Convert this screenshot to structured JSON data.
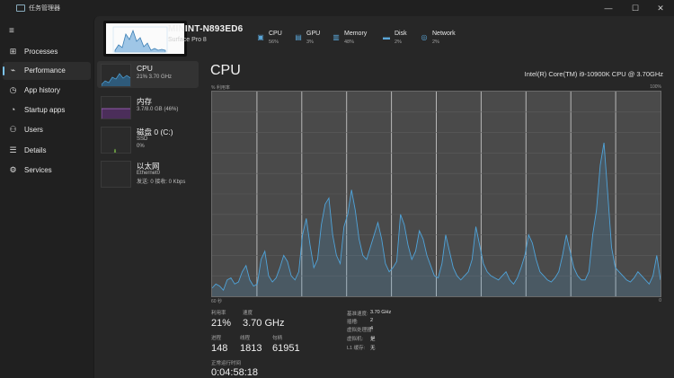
{
  "window": {
    "title": "任务管理器",
    "minimize": "—",
    "maximize": "☐",
    "close": "✕"
  },
  "nav": {
    "items": [
      {
        "label": "Processes",
        "icon": "grid-icon"
      },
      {
        "label": "Performance",
        "icon": "pulse-icon"
      },
      {
        "label": "App history",
        "icon": "history-icon"
      },
      {
        "label": "Startup apps",
        "icon": "speedometer-icon"
      },
      {
        "label": "Users",
        "icon": "users-icon"
      },
      {
        "label": "Details",
        "icon": "list-icon"
      },
      {
        "label": "Services",
        "icon": "gear-icon"
      }
    ],
    "active_index": 1
  },
  "header": {
    "device_name": "MININT-N893ED6",
    "device_model": "Surface Pro 8",
    "metrics": [
      {
        "name": "CPU",
        "value": "56%"
      },
      {
        "name": "GPU",
        "value": "3%"
      },
      {
        "name": "Memory",
        "value": "48%"
      },
      {
        "name": "Disk",
        "value": "2%"
      },
      {
        "name": "Network",
        "value": "2%"
      }
    ]
  },
  "devices": [
    {
      "title": "CPU",
      "sub1": "21% 3.70 GHz",
      "graph_color": "#4fa3d9"
    },
    {
      "title": "内存",
      "sub1": "3.7/8.0 GB (46%)",
      "graph_color": "#b06ad0"
    },
    {
      "title": "磁盘 0 (C:)",
      "sub1": "SSD",
      "sub2": "0%",
      "graph_color": "#7fbf4a"
    },
    {
      "title": "以太网",
      "sub1": "Ethernet0",
      "sub2": "发送: 0 接收: 0 Kbps",
      "graph_color": "#c9a23a"
    }
  ],
  "main": {
    "title": "CPU",
    "model": "Intel(R) Core(TM) i9-10900K CPU @ 3.70GHz",
    "graph_top_left": "% 利用率",
    "graph_top_right": "100%",
    "graph_bottom_left": "60 秒",
    "graph_bottom_right": "0",
    "stats": [
      {
        "label": "利用率",
        "value": "21%"
      },
      {
        "label": "速度",
        "value": "3.70 GHz"
      },
      {
        "label": "进程",
        "value": "148"
      },
      {
        "label": "线程",
        "value": "1813"
      },
      {
        "label": "句柄",
        "value": "61951"
      },
      {
        "label": "正常运行时间",
        "value": "0:04:58:18"
      }
    ],
    "specs": [
      {
        "label": "基准速度:",
        "value": "3.70 GHz"
      },
      {
        "label": "插槽:",
        "value": "2"
      },
      {
        "label": "虚拟处理器:",
        "value": "4"
      },
      {
        "label": "虚拟机:",
        "value": "是"
      },
      {
        "label": "L1 缓存:",
        "value": "无"
      }
    ]
  },
  "chart_data": {
    "type": "area",
    "ylim": [
      0,
      100
    ],
    "color": "#4fa3d9",
    "values": [
      4,
      6,
      5,
      3,
      8,
      9,
      6,
      7,
      12,
      15,
      8,
      5,
      6,
      18,
      22,
      10,
      7,
      9,
      14,
      20,
      17,
      10,
      8,
      12,
      30,
      38,
      25,
      14,
      18,
      35,
      45,
      48,
      30,
      20,
      16,
      34,
      40,
      52,
      42,
      28,
      20,
      18,
      24,
      30,
      36,
      28,
      16,
      12,
      14,
      17,
      40,
      35,
      25,
      18,
      22,
      32,
      28,
      20,
      15,
      10,
      9,
      16,
      30,
      22,
      14,
      10,
      8,
      10,
      12,
      18,
      34,
      25,
      16,
      12,
      10,
      9,
      8,
      10,
      12,
      8,
      6,
      9,
      14,
      20,
      30,
      26,
      18,
      12,
      10,
      8,
      7,
      9,
      12,
      20,
      30,
      22,
      14,
      10,
      8,
      8,
      12,
      30,
      42,
      64,
      75,
      50,
      24,
      14,
      12,
      10,
      8,
      7,
      9,
      12,
      10,
      8,
      6,
      10,
      20,
      8
    ]
  }
}
